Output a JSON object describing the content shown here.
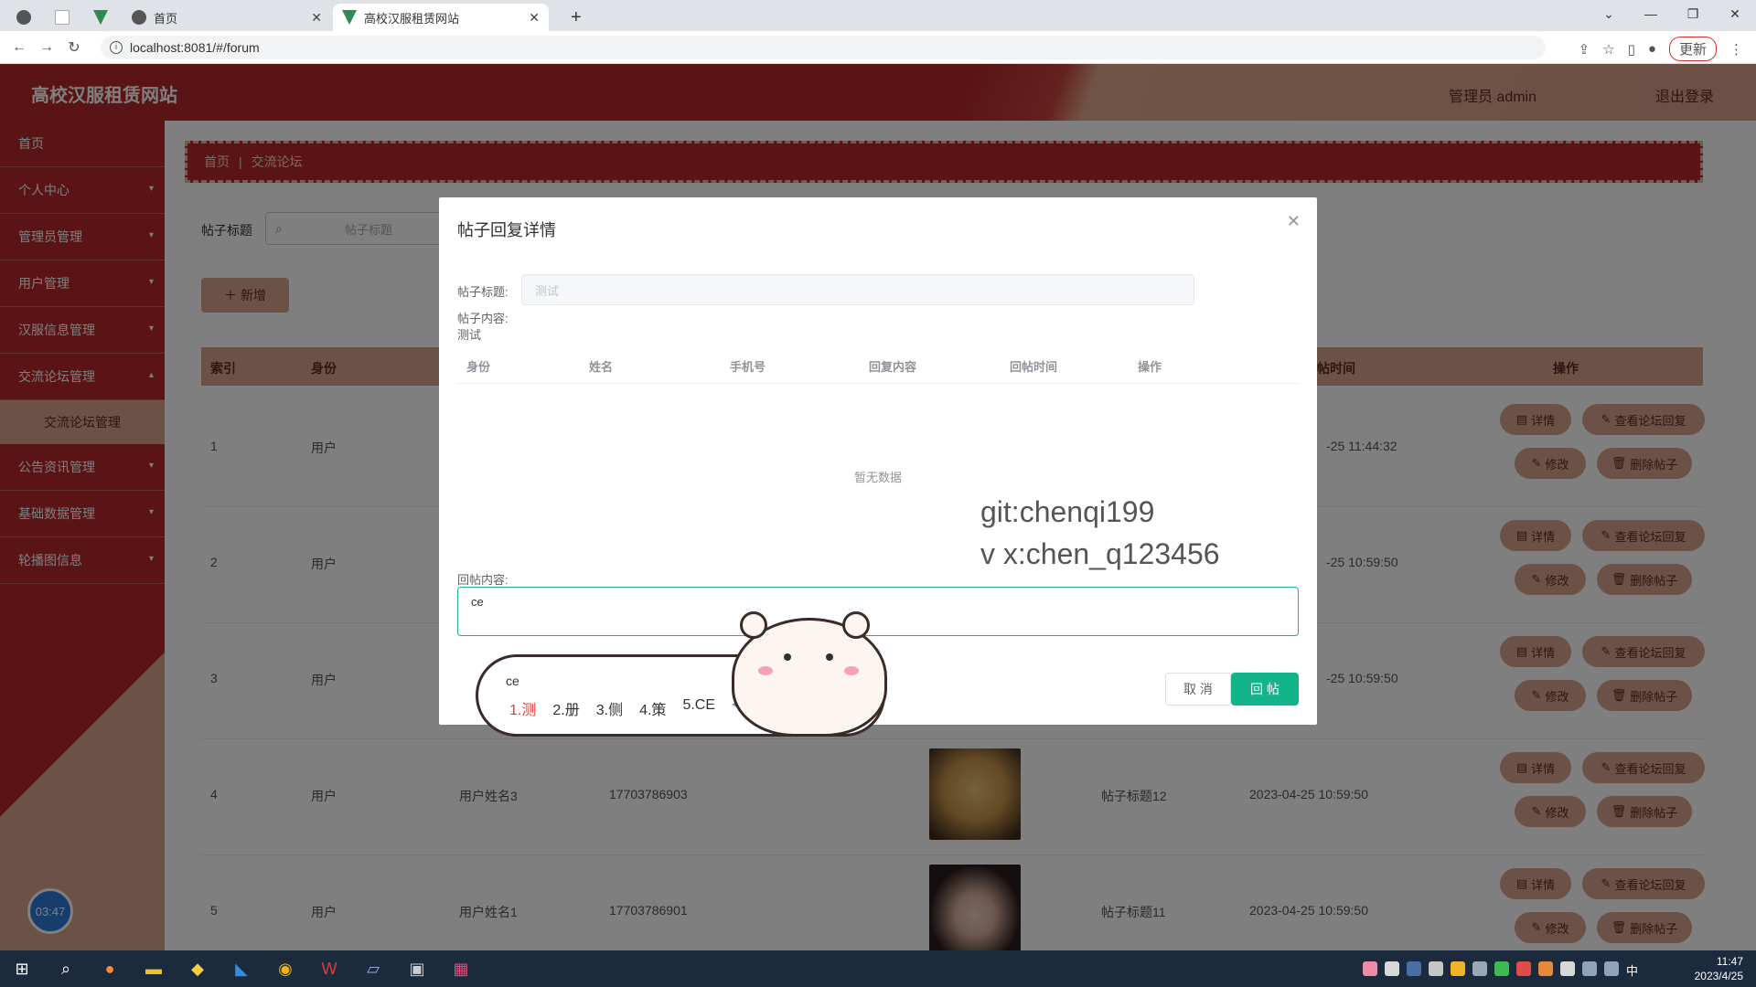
{
  "browser": {
    "tabs": [
      {
        "label": "",
        "icon": "globe-icon"
      },
      {
        "label": "",
        "icon": "blank-icon"
      },
      {
        "label": "",
        "icon": "vue-icon"
      },
      {
        "label": "首页",
        "icon": "globe-icon"
      },
      {
        "label": "高校汉服租赁网站",
        "icon": "vue-icon"
      }
    ],
    "url": "localhost:8081/#/forum",
    "update_label": "更新"
  },
  "header": {
    "title": "高校汉服租赁网站",
    "user": "管理员 admin",
    "logout": "退出登录"
  },
  "sidebar": {
    "items": [
      {
        "label": "首页"
      },
      {
        "label": "个人中心"
      },
      {
        "label": "管理员管理"
      },
      {
        "label": "用户管理"
      },
      {
        "label": "汉服信息管理"
      },
      {
        "label": "交流论坛管理"
      },
      {
        "label": "公告资讯管理"
      },
      {
        "label": "基础数据管理"
      },
      {
        "label": "轮播图信息"
      }
    ],
    "sub_active": "交流论坛管理",
    "timer": "03:47"
  },
  "main": {
    "breadcrumb": [
      "首页",
      "交流论坛"
    ],
    "search_label": "帖子标题",
    "search_placeholder": "帖子标题",
    "add_label": "新增",
    "columns": [
      "索引",
      "身份",
      "帖时间",
      "操作"
    ],
    "rows": [
      {
        "index": "1",
        "role": "用户",
        "name": "",
        "phone": "",
        "title": "",
        "time": "-25 11:44:32"
      },
      {
        "index": "2",
        "role": "用户",
        "name": "",
        "phone": "",
        "title": "",
        "time": "-25 10:59:50"
      },
      {
        "index": "3",
        "role": "用户",
        "name": "",
        "phone": "",
        "title": "",
        "time": "-25 10:59:50"
      },
      {
        "index": "4",
        "role": "用户",
        "name": "用户姓名3",
        "phone": "17703786903",
        "title": "帖子标题12",
        "time": "2023-04-25 10:59:50"
      },
      {
        "index": "5",
        "role": "用户",
        "name": "用户姓名1",
        "phone": "17703786901",
        "title": "帖子标题11",
        "time": "2023-04-25 10:59:50"
      }
    ],
    "ops": {
      "detail": "详情",
      "view_reply": "查看论坛回复",
      "edit": "修改",
      "delete": "删除帖子"
    }
  },
  "dialog": {
    "title": "帖子回复详情",
    "post_title_label": "帖子标题:",
    "post_title_value": "测试",
    "post_content_label": "帖子内容:",
    "post_content_value": "测试",
    "columns": [
      "身份",
      "姓名",
      "手机号",
      "回复内容",
      "回帖时间",
      "操作"
    ],
    "empty_text": "暂无数据",
    "reply_label": "回帖内容:",
    "reply_value": "ce",
    "cancel_label": "取 消",
    "submit_label": "回 帖"
  },
  "watermark": {
    "line1": "git:chenqi199",
    "line2": "v x:chen_q123456"
  },
  "ime": {
    "typed": "ce",
    "candidates": [
      "1.测",
      "2.册",
      "3.侧",
      "4.策",
      "5.CE"
    ]
  },
  "taskbar": {
    "time": "11:47",
    "date": "2023/4/25",
    "ime_lang": "中"
  }
}
